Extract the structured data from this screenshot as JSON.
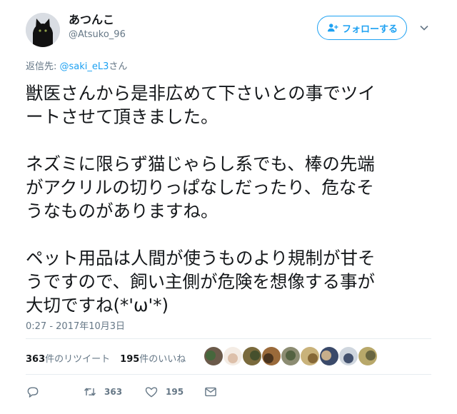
{
  "user": {
    "display_name": "あつんこ",
    "screen_name": "@Atsuko_96"
  },
  "follow_button": {
    "label": "フォローする"
  },
  "reply_to": {
    "prefix": "返信先: ",
    "mention": "@saki_eL3",
    "suffix": "さん"
  },
  "tweet": {
    "lines": [
      "獣医さんから是非広めて下さいとの事でツイ",
      "ートさせて頂きました。",
      "",
      "ネズミに限らず猫じゃらし系でも、棒の先端",
      "がアクリルの切りっぱなしだったり、危なそ",
      "うなものがありますね。",
      "",
      "ペット用品は人間が使うものより規制が甘そ",
      "うですので、飼い主側が危険を想像する事が",
      "大切ですね(*'ω'*)"
    ],
    "timestamp": "0:27 - 2017年10月3日"
  },
  "stats": {
    "retweets_count": "363",
    "retweets_label": "件のリツイート",
    "likes_count": "195",
    "likes_label": "件のいいね"
  },
  "liker_avatars": [
    {
      "color": "#6b5a4a",
      "accent": "#3f6a3a"
    },
    {
      "color": "#f4ece4",
      "accent": "#d8b9a0"
    },
    {
      "color": "#7a6a3c",
      "accent": "#3d4b2a"
    },
    {
      "color": "#9a6a3a",
      "accent": "#3c2a1a"
    },
    {
      "color": "#8c8c72",
      "accent": "#4a5a3a"
    },
    {
      "color": "#c9b27a",
      "accent": "#7a5a2a"
    },
    {
      "color": "#3b4a6a",
      "accent": "#e0c090"
    },
    {
      "color": "#cfd6de",
      "accent": "#2a3a5a"
    },
    {
      "color": "#b8a86a",
      "accent": "#5a5a3a"
    }
  ],
  "actions": {
    "reply_count": "",
    "retweet_count": "363",
    "like_count": "195"
  },
  "colors": {
    "accent": "#1da1f2",
    "secondary_text": "#657786",
    "divider": "#e6ecf0"
  },
  "icons": {
    "reply": "reply-icon",
    "retweet": "retweet-icon",
    "like": "heart-icon",
    "dm": "envelope-icon",
    "follow": "add-user-icon",
    "more": "chevron-down-icon"
  }
}
